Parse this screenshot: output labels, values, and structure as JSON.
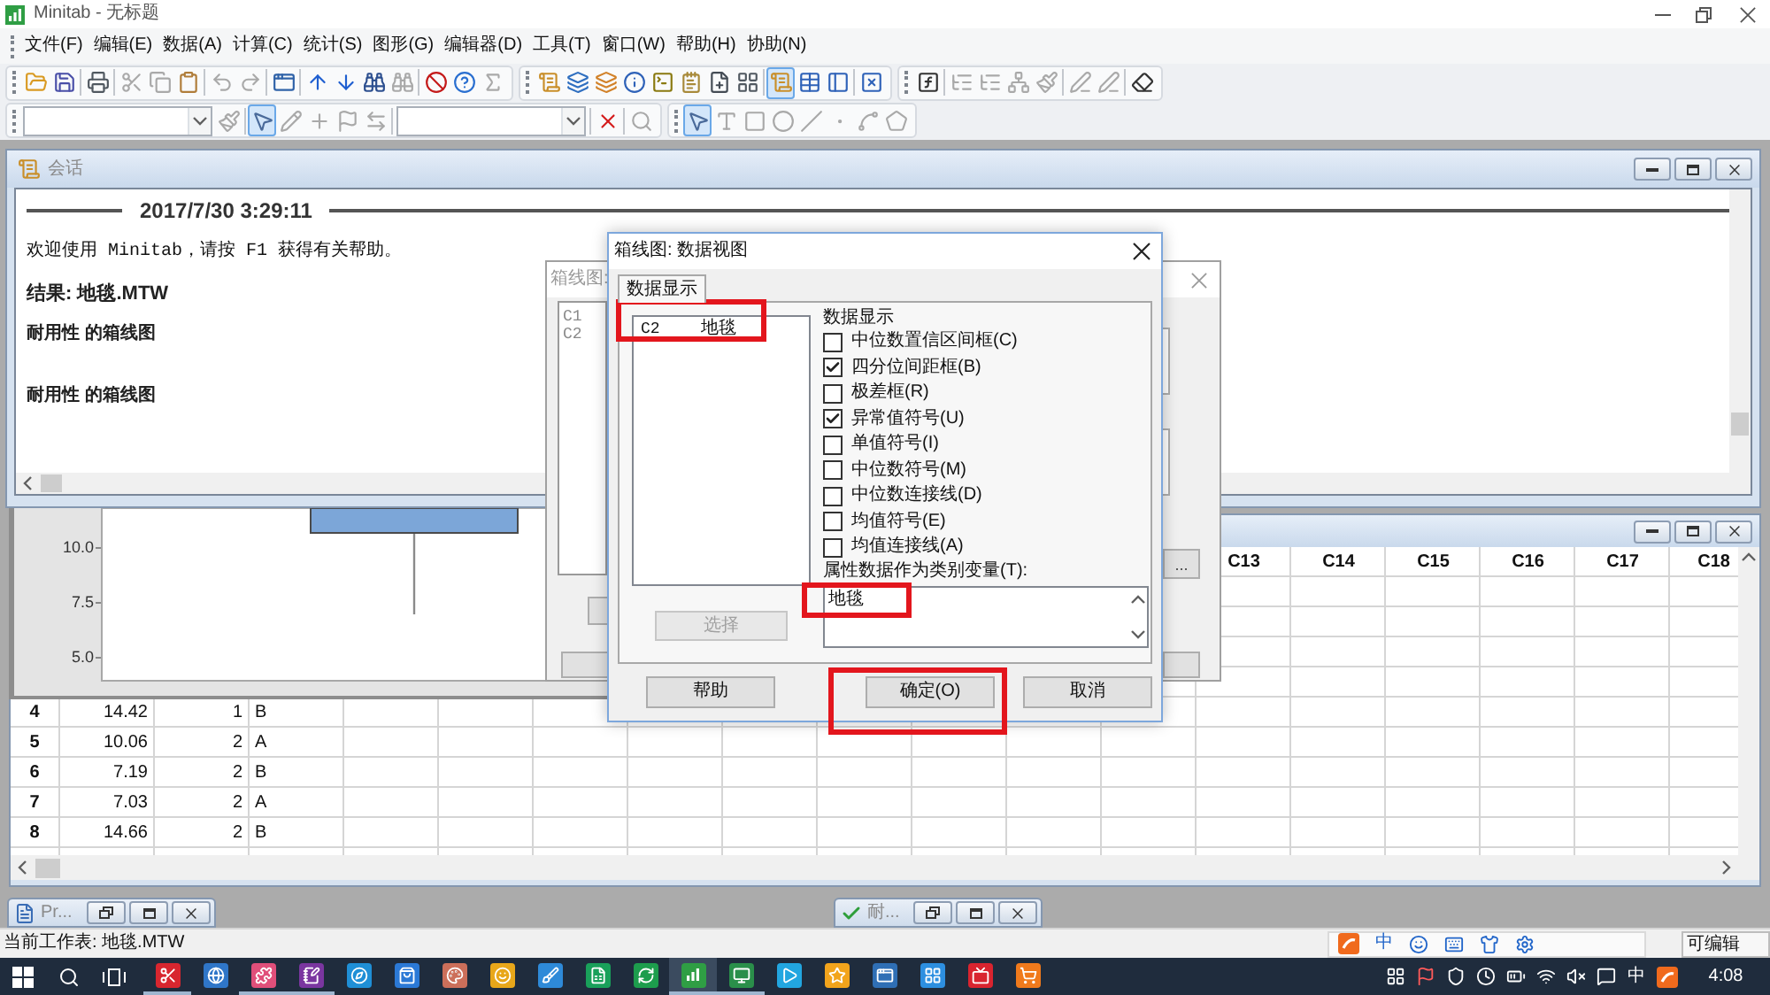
{
  "window": {
    "title": "Minitab - 无标题"
  },
  "menu": [
    "文件(F)",
    "编辑(E)",
    "数据(A)",
    "计算(C)",
    "统计(S)",
    "图形(G)",
    "编辑器(D)",
    "工具(T)",
    "窗口(W)",
    "帮助(H)",
    "协助(N)"
  ],
  "toolbar_rows": [
    [
      [
        {
          "kind": "open",
          "disabled": false,
          "pressed": false
        },
        {
          "kind": "save",
          "disabled": false,
          "pressed": false
        },
        {
          "kind": "separator"
        },
        {
          "kind": "print",
          "disabled": false,
          "pressed": false
        },
        {
          "kind": "separator"
        },
        {
          "kind": "cut",
          "disabled": true,
          "pressed": false
        },
        {
          "kind": "copy",
          "disabled": true,
          "pressed": false
        },
        {
          "kind": "paste",
          "disabled": false,
          "pressed": false
        },
        {
          "kind": "separator"
        },
        {
          "kind": "undo",
          "disabled": true,
          "pressed": false
        },
        {
          "kind": "redo",
          "disabled": true,
          "pressed": false
        },
        {
          "kind": "separator"
        },
        {
          "kind": "session_window",
          "disabled": false,
          "pressed": false
        },
        {
          "kind": "separator"
        },
        {
          "kind": "up",
          "disabled": false,
          "pressed": false
        },
        {
          "kind": "down",
          "disabled": false,
          "pressed": false
        },
        {
          "kind": "find",
          "disabled": false,
          "pressed": false
        },
        {
          "kind": "find_next",
          "disabled": true,
          "pressed": false
        },
        {
          "kind": "separator"
        },
        {
          "kind": "cancel",
          "disabled": false,
          "pressed": false
        },
        {
          "kind": "help",
          "disabled": false,
          "pressed": false
        },
        {
          "kind": "sum",
          "disabled": true,
          "pressed": false
        }
      ],
      [
        {
          "kind": "scroll",
          "disabled": false,
          "pressed": false
        },
        {
          "kind": "worksheets",
          "disabled": false,
          "pressed": false
        },
        {
          "kind": "graphs",
          "disabled": false,
          "pressed": false
        },
        {
          "kind": "info",
          "disabled": false,
          "pressed": false
        },
        {
          "kind": "command",
          "disabled": false,
          "pressed": false
        },
        {
          "kind": "notepad",
          "disabled": false,
          "pressed": false
        },
        {
          "kind": "new_doc",
          "disabled": false,
          "pressed": false
        },
        {
          "kind": "layout",
          "disabled": false,
          "pressed": false
        },
        {
          "kind": "separator"
        },
        {
          "kind": "session",
          "disabled": false,
          "pressed": true
        },
        {
          "kind": "table",
          "disabled": false,
          "pressed": false
        },
        {
          "kind": "panel",
          "disabled": false,
          "pressed": false
        },
        {
          "kind": "separator"
        },
        {
          "kind": "close_graphs",
          "disabled": false,
          "pressed": false
        }
      ],
      [
        {
          "kind": "fx",
          "disabled": false,
          "pressed": false
        },
        {
          "kind": "separator"
        },
        {
          "kind": "tree1",
          "disabled": true,
          "pressed": false
        },
        {
          "kind": "tree2",
          "disabled": true,
          "pressed": false
        },
        {
          "kind": "chart_tree",
          "disabled": true,
          "pressed": false
        },
        {
          "kind": "brush",
          "disabled": true,
          "pressed": false
        },
        {
          "kind": "separator"
        },
        {
          "kind": "pen_plus",
          "disabled": true,
          "pressed": false
        },
        {
          "kind": "pen_minus",
          "disabled": true,
          "pressed": false
        },
        {
          "kind": "separator"
        },
        {
          "kind": "eraser",
          "disabled": false,
          "pressed": false
        }
      ]
    ],
    [
      [
        {
          "kind": "dropdown"
        },
        {
          "kind": "brush_tool",
          "disabled": true,
          "pressed": false
        },
        {
          "kind": "separator"
        },
        {
          "kind": "pointer",
          "disabled": false,
          "pressed": true
        },
        {
          "kind": "pen",
          "disabled": true,
          "pressed": false
        },
        {
          "kind": "crosshair",
          "disabled": true,
          "pressed": false
        },
        {
          "kind": "flag",
          "disabled": true,
          "pressed": false
        },
        {
          "kind": "swap",
          "disabled": true,
          "pressed": false
        },
        {
          "kind": "separator"
        },
        {
          "kind": "dropdown"
        },
        {
          "kind": "separator"
        },
        {
          "kind": "delete",
          "disabled": false,
          "pressed": false
        },
        {
          "kind": "separator"
        },
        {
          "kind": "zoom",
          "disabled": true,
          "pressed": false
        }
      ],
      [
        {
          "kind": "pointer",
          "disabled": false,
          "pressed": true
        },
        {
          "kind": "text",
          "disabled": true,
          "pressed": false
        },
        {
          "kind": "rect",
          "disabled": true,
          "pressed": false
        },
        {
          "kind": "ellipse",
          "disabled": true,
          "pressed": false
        },
        {
          "kind": "line",
          "disabled": true,
          "pressed": false
        },
        {
          "kind": "dot",
          "disabled": true,
          "pressed": false
        },
        {
          "kind": "polyline",
          "disabled": true,
          "pressed": false
        },
        {
          "kind": "polygon",
          "disabled": true,
          "pressed": false
        }
      ]
    ]
  ],
  "session": {
    "title": "会话",
    "timestamp": "2017/7/30 3:29:11",
    "lines": [
      {
        "kind": "welcome",
        "text": "欢迎使用 Minitab，请按 F1 获得有关帮助。"
      },
      {
        "kind": "result",
        "text": "结果: 地毯.MTW"
      },
      {
        "kind": "graph_title",
        "text": "耐用性 的箱线图"
      },
      {
        "kind": "graph_title",
        "text": "耐用性 的箱线图"
      }
    ]
  },
  "graph": {
    "y_tick_labels": [
      "10.0",
      "7.5",
      "5.0"
    ]
  },
  "worksheet": {
    "columns": [
      "C13",
      "C14",
      "C15",
      "C16",
      "C17",
      "C18"
    ],
    "rows": [
      {
        "number": "4",
        "cells": [
          "14.42",
          "1",
          "B"
        ]
      },
      {
        "number": "5",
        "cells": [
          "10.06",
          "2",
          "A"
        ]
      },
      {
        "number": "6",
        "cells": [
          "7.19",
          "2",
          "B"
        ]
      },
      {
        "number": "7",
        "cells": [
          "7.03",
          "2",
          "A"
        ]
      },
      {
        "number": "8",
        "cells": [
          "14.66",
          "2",
          "B"
        ]
      }
    ]
  },
  "minimized_windows": [
    {
      "kind": "project",
      "title": "Pr..."
    },
    {
      "kind": "graph",
      "title": "耐..."
    }
  ],
  "back_dialog": {
    "title": "箱线图:",
    "variables": [
      "C1",
      "C2"
    ],
    "button": "..."
  },
  "dialog": {
    "title": "箱线图: 数据视图",
    "tab": {
      "label": "数据显示",
      "selected": true
    },
    "variables": [
      {
        "column": "C2",
        "name": "地毯",
        "highlighted": true
      }
    ],
    "select_button": {
      "label": "选择",
      "disabled": true
    },
    "group_label": "数据显示",
    "options": [
      {
        "label": "中位数置信区间框(C)",
        "checked": false
      },
      {
        "label": "四分位间距框(B)",
        "checked": true
      },
      {
        "label": "极差框(R)",
        "checked": false
      },
      {
        "label": "异常值符号(U)",
        "checked": true
      },
      {
        "label": "单值符号(I)",
        "checked": false
      },
      {
        "label": "中位数符号(M)",
        "checked": false
      },
      {
        "label": "中位数连接线(D)",
        "checked": false
      },
      {
        "label": "均值符号(E)",
        "checked": false
      },
      {
        "label": "均值连接线(A)",
        "checked": false
      }
    ],
    "category_label": "属性数据作为类别变量(T):",
    "category_value": "地毯",
    "category_highlighted": true,
    "buttons": [
      {
        "label": "帮助",
        "highlighted": false
      },
      {
        "label": "确定(O)",
        "highlighted": true
      },
      {
        "label": "取消",
        "highlighted": false
      }
    ]
  },
  "status_bar": {
    "text": "当前工作表: 地毯.MTW",
    "input_mode": "中",
    "mode": "可编辑"
  },
  "taskbar": {
    "apps": [
      {
        "kind": "scissors",
        "running": true,
        "active": false
      },
      {
        "kind": "globe",
        "running": false,
        "active": false
      },
      {
        "kind": "puzzle",
        "running": true,
        "active": false
      },
      {
        "kind": "notebook",
        "running": true,
        "active": false
      },
      {
        "kind": "compass",
        "running": false,
        "active": false
      },
      {
        "kind": "bag",
        "running": false,
        "active": false
      },
      {
        "kind": "palette",
        "running": false,
        "active": false
      },
      {
        "kind": "smile",
        "running": false,
        "active": false
      },
      {
        "kind": "brush",
        "running": false,
        "active": false
      },
      {
        "kind": "sheet",
        "running": false,
        "active": false
      },
      {
        "kind": "refresh",
        "running": false,
        "active": false
      },
      {
        "kind": "chart",
        "running": true,
        "active": true
      },
      {
        "kind": "monitor",
        "running": true,
        "active": false
      },
      {
        "kind": "play",
        "running": false,
        "active": false
      },
      {
        "kind": "star",
        "running": false,
        "active": false
      },
      {
        "kind": "window",
        "running": false,
        "active": false
      },
      {
        "kind": "grid",
        "running": false,
        "active": false
      },
      {
        "kind": "tv",
        "running": false,
        "active": false
      },
      {
        "kind": "cart",
        "running": false,
        "active": false
      }
    ],
    "input_mode": "中",
    "time": "4:08"
  }
}
